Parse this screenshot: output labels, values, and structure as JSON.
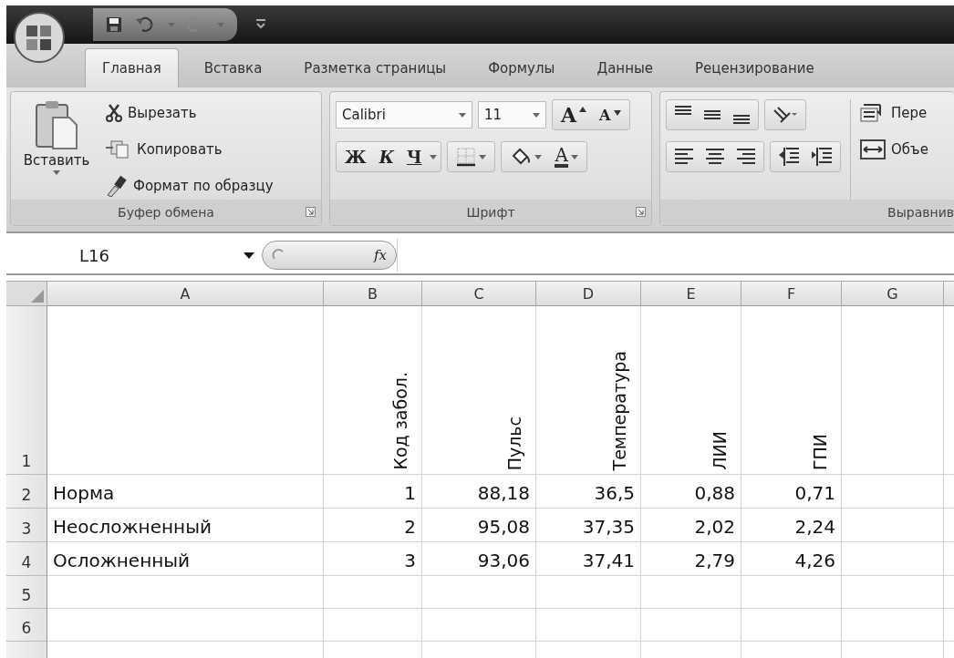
{
  "tabs": [
    {
      "label": "Главная",
      "selected": true
    },
    {
      "label": "Вставка",
      "selected": false
    },
    {
      "label": "Разметка страницы",
      "selected": false
    },
    {
      "label": "Формулы",
      "selected": false
    },
    {
      "label": "Данные",
      "selected": false
    },
    {
      "label": "Рецензирование",
      "selected": false
    }
  ],
  "ribbon": {
    "groups": [
      {
        "kind": "clipboard",
        "label": "Буфер обмена",
        "paste_label": "Вставить",
        "commands": [
          {
            "kind": "cut",
            "label": "Вырезать"
          },
          {
            "kind": "copy",
            "label": "Копировать"
          },
          {
            "kind": "painter",
            "label": "Формат по образцу"
          }
        ]
      },
      {
        "kind": "font",
        "label": "Шрифт",
        "font_name": "Calibri",
        "font_size": "11",
        "row1": [
          {
            "kind": "grow",
            "label": "A"
          },
          {
            "kind": "shrink",
            "label": "A"
          }
        ],
        "row2": [
          {
            "kind": "bold",
            "label": "Ж"
          },
          {
            "kind": "italic",
            "label": "К"
          },
          {
            "kind": "underline",
            "label": "Ч"
          },
          {
            "kind": "borders"
          },
          {
            "kind": "fill"
          },
          {
            "kind": "font_color",
            "label": "A"
          }
        ]
      },
      {
        "kind": "alignment",
        "label": "Выравнив",
        "commands": [
          {
            "kind": "wrap",
            "label": "Пере"
          },
          {
            "kind": "merge",
            "label": "Объе"
          }
        ]
      }
    ]
  },
  "formula_bar": {
    "name_box": "L16",
    "function_label": "fx"
  },
  "sheet": {
    "columns": [
      "A",
      "B",
      "C",
      "D",
      "E",
      "F",
      "G"
    ],
    "rows": [
      {
        "number": "1",
        "kind": "header",
        "cells": [
          null,
          "Код забол.",
          "Пульс",
          "Температура",
          "ЛИИ",
          "ГПИ",
          null
        ]
      },
      {
        "number": "2",
        "kind": "data",
        "cells": [
          "Норма",
          "1",
          "88,18",
          "36,5",
          "0,88",
          "0,71",
          null
        ]
      },
      {
        "number": "3",
        "kind": "data",
        "cells": [
          "Неосложненный",
          "2",
          "95,08",
          "37,35",
          "2,02",
          "2,24",
          null
        ]
      },
      {
        "number": "4",
        "kind": "data",
        "cells": [
          "Осложненный",
          "3",
          "93,06",
          "37,41",
          "2,79",
          "4,26",
          null
        ]
      },
      {
        "number": "5",
        "kind": "data"
      },
      {
        "number": "6",
        "kind": "data"
      }
    ]
  }
}
